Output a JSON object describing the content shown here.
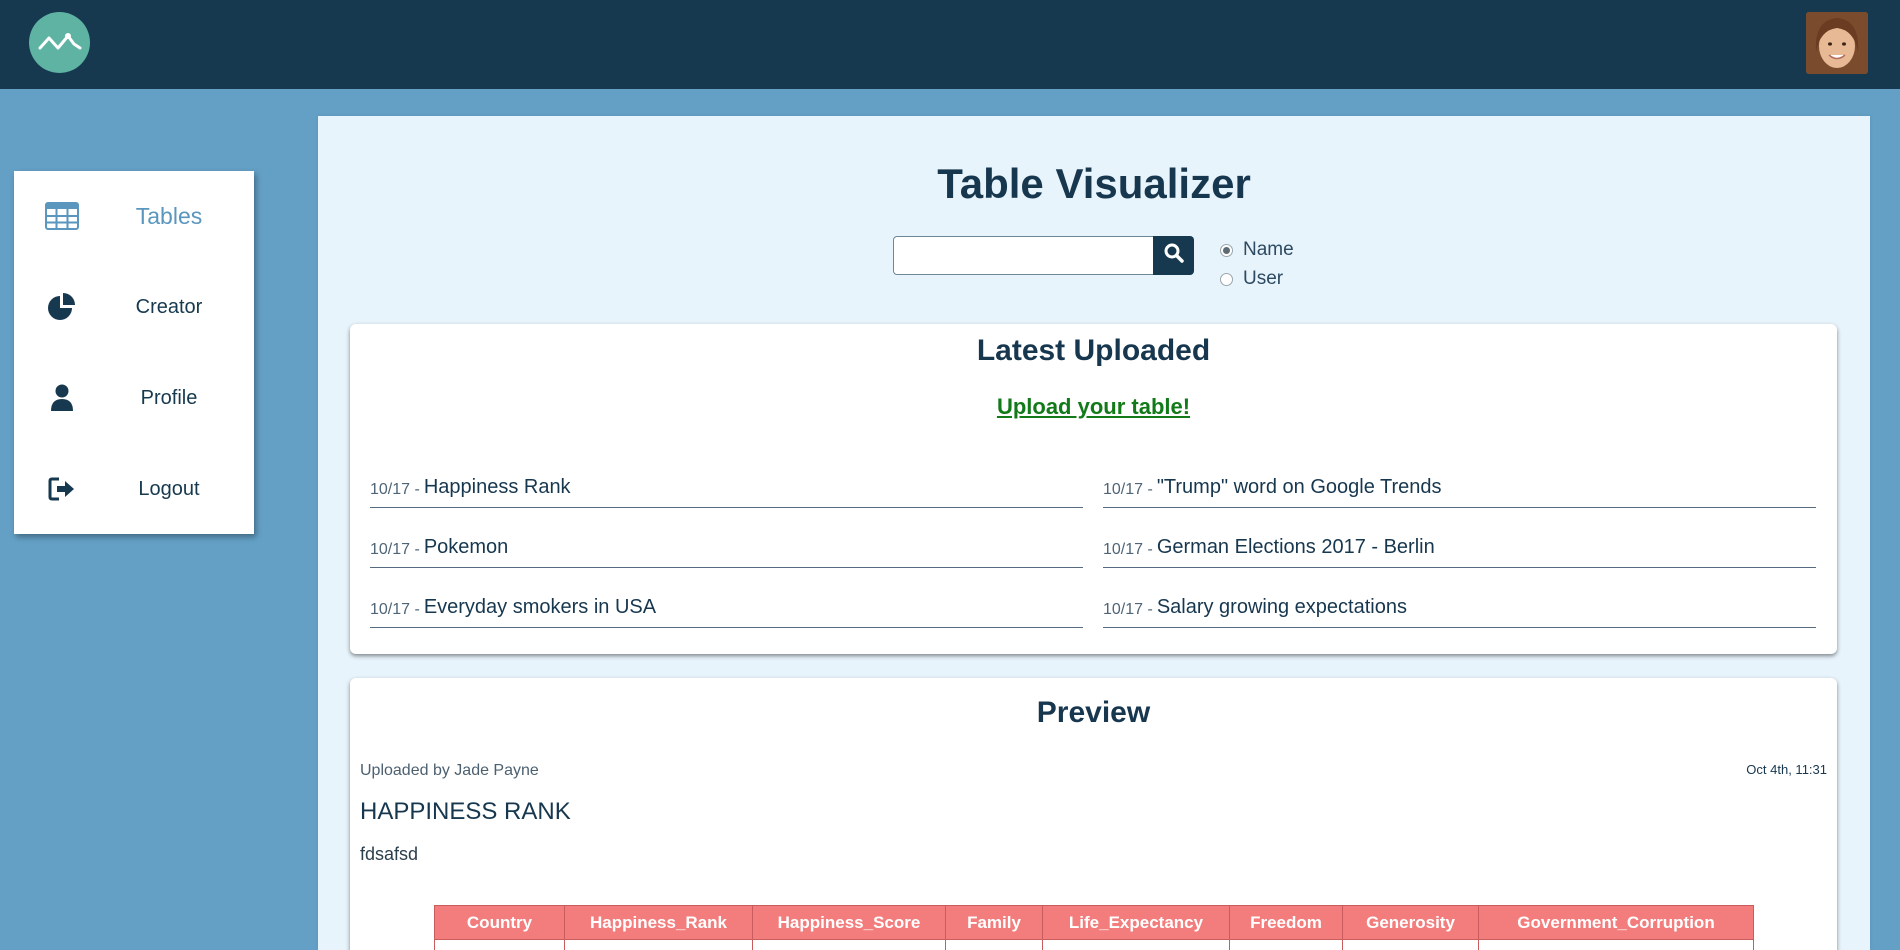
{
  "header": {
    "logo_icon": "pulse-logo-icon",
    "avatar_icon": "user-avatar"
  },
  "sidebar": {
    "items": [
      {
        "label": "Tables",
        "icon": "table-icon",
        "active": true
      },
      {
        "label": "Creator",
        "icon": "pie-chart-icon",
        "active": false
      },
      {
        "label": "Profile",
        "icon": "user-icon",
        "active": false
      },
      {
        "label": "Logout",
        "icon": "logout-icon",
        "active": false
      }
    ]
  },
  "main": {
    "title": "Table Visualizer",
    "search": {
      "value": "",
      "placeholder": "",
      "icon": "search-icon"
    },
    "filters": [
      {
        "label": "Name",
        "checked": true
      },
      {
        "label": "User",
        "checked": false
      }
    ]
  },
  "latest": {
    "title": "Latest Uploaded",
    "upload_link": "Upload your table!",
    "entries": [
      {
        "date": "10/17 -",
        "name": "Happiness Rank"
      },
      {
        "date": "10/17 -",
        "name": "\"Trump\" word on Google Trends"
      },
      {
        "date": "10/17 -",
        "name": "Pokemon"
      },
      {
        "date": "10/17 -",
        "name": "German Elections 2017 - Berlin"
      },
      {
        "date": "10/17 -",
        "name": "Everyday smokers in USA"
      },
      {
        "date": "10/17 -",
        "name": "Salary growing expectations"
      }
    ]
  },
  "preview": {
    "title": "Preview",
    "uploaded_by": "Uploaded by Jade Payne",
    "timestamp": "Oct 4th, 11:31",
    "table_name": "HAPPINESS RANK",
    "description": "fdsafsd",
    "columns": [
      "Country",
      "Happiness_Rank",
      "Happiness_Score",
      "Family",
      "Life_Expectancy",
      "Freedom",
      "Generosity",
      "Government_Corruption"
    ]
  },
  "colors": {
    "topbar": "#17394f",
    "background": "#64a0c6",
    "accent": "#5a96bd",
    "link": "#137a1a",
    "table_header": "#f37d7d"
  }
}
